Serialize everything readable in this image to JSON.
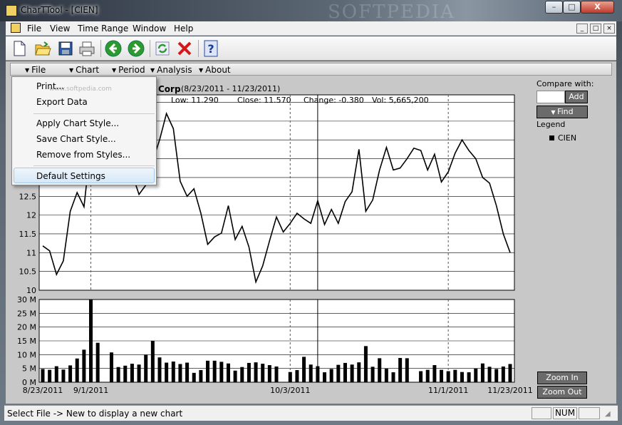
{
  "window": {
    "title": "CharTTool - [CIEN]",
    "watermark": "SOFTPEDIA",
    "min_glyph": "–",
    "max_glyph": "□",
    "close_glyph": "X"
  },
  "menubar": {
    "items": [
      "File",
      "View",
      "Time Range",
      "Window",
      "Help"
    ],
    "mdi_min": "_",
    "mdi_restore": "□",
    "mdi_close": "×"
  },
  "toolbar": {
    "buttons": [
      "new-file",
      "open-folder",
      "save",
      "print",
      "back",
      "forward",
      "refresh",
      "delete",
      "help"
    ]
  },
  "subbar": {
    "items": [
      "File",
      "Chart",
      "Period",
      "Analysis",
      "About"
    ]
  },
  "dropdown": {
    "items": [
      "Print...",
      "Export Data",
      "Apply Chart Style...",
      "Save Chart Style...",
      "Remove from Styles...",
      "Default Settings"
    ],
    "highlighted": "Default Settings",
    "watermark": "www.softpedia.com"
  },
  "info": {
    "company": "Corp",
    "range": "(8/23/2011 - 11/23/2011)",
    "low": "Low: 11.290",
    "close": "Close: 11.570",
    "change": "Change: -0.380",
    "vol": "Vol: 5,665,200"
  },
  "compare": {
    "label": "Compare with:",
    "input": "",
    "add_label": "Add",
    "find_label": "Find",
    "legend_label": "Legend",
    "legend_item": "CIEN"
  },
  "zoom": {
    "in_label": "Zoom In",
    "out_label": "Zoom Out"
  },
  "status": {
    "text": "Select File -> New to display a new chart",
    "num": "NUM"
  },
  "colors": {
    "accent": "#6b6b6b",
    "price_line": "#000000",
    "grid": "#000000"
  },
  "chart_data": {
    "type": "line",
    "x_tick_labels": [
      "8/23/2011",
      "9/1/2011",
      "10/3/2011",
      "11/1/2011",
      "11/23/2011"
    ],
    "price": {
      "ylim": [
        10,
        15.2
      ],
      "y_ticks": [
        10,
        10.5,
        11,
        11.5,
        12,
        12.5
      ],
      "values": [
        11.18,
        11.05,
        10.42,
        10.78,
        12.1,
        12.6,
        12.22,
        13.9,
        14.5,
        14.9,
        14.4,
        14.2,
        13.6,
        13.1,
        12.55,
        12.8,
        13.45,
        14.0,
        14.7,
        14.3,
        12.9,
        12.5,
        12.7,
        12.05,
        11.22,
        11.42,
        11.52,
        12.25,
        11.35,
        11.7,
        11.15,
        10.22,
        10.65,
        11.32,
        11.95,
        11.55,
        11.78,
        12.05,
        11.9,
        11.78,
        12.38,
        11.75,
        12.15,
        11.78,
        12.36,
        12.62,
        13.75,
        12.1,
        12.4,
        13.2,
        13.8,
        13.2,
        13.25,
        13.5,
        13.78,
        13.72,
        13.2,
        13.62,
        12.88,
        13.15,
        13.65,
        14.0,
        13.72,
        13.5,
        13.0,
        12.85,
        12.25,
        11.5,
        11.0
      ]
    },
    "volume": {
      "ylim": [
        0,
        30
      ],
      "y_tick_labels": [
        "0 M",
        "5 M",
        "10 M",
        "15 M",
        "20 M",
        "25 M",
        "30 M"
      ],
      "values": [
        4.8,
        4.5,
        5.8,
        4.6,
        6.1,
        8.6,
        11.8,
        29.9,
        14.3,
        0,
        10.8,
        5.5,
        6.0,
        6.7,
        6.4,
        9.9,
        15.0,
        9.0,
        7.1,
        7.5,
        6.6,
        7.1,
        3.4,
        4.4,
        7.8,
        7.8,
        7.4,
        6.8,
        4.2,
        5.5,
        7.0,
        7.2,
        6.7,
        6.2,
        5.7,
        0,
        3.7,
        4.4,
        9.2,
        6.4,
        5.8,
        3.6,
        4.8,
        6.3,
        7.0,
        6.4,
        7.2,
        13.1,
        5.6,
        8.7,
        4.9,
        3.6,
        8.8,
        8.7,
        0,
        4.0,
        4.5,
        6.2,
        4.5,
        4.0,
        4.5,
        3.7,
        3.6,
        5.0,
        6.8,
        5.6,
        4.8,
        5.7,
        6.6
      ]
    }
  }
}
